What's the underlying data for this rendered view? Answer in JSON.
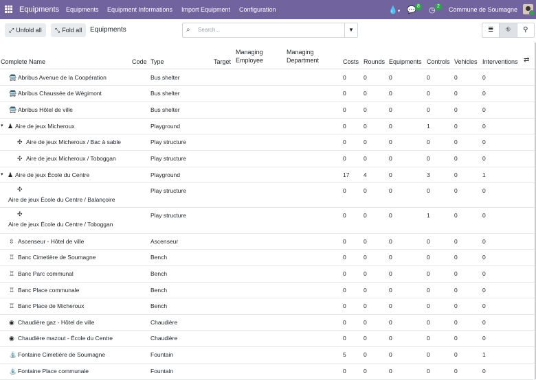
{
  "app": {
    "title": "Equipments",
    "menu": [
      "Equipments",
      "Equipment Informations",
      "Import Equipment",
      "Configuration"
    ],
    "badges": {
      "messages": "8",
      "activities": "2"
    },
    "company": "Commune de Soumagne"
  },
  "control_panel": {
    "unfold_label": "Unfold all",
    "fold_label": "Fold all",
    "page_title": "Equipments",
    "search_placeholder": "Search..."
  },
  "columns": [
    "Complete Name",
    "Code",
    "Type",
    "Target",
    "Managing Employee",
    "Managing Department",
    "Costs",
    "Rounds",
    "Equipments",
    "Controls",
    "Vehicles",
    "Interventions"
  ],
  "rows": [
    {
      "name": "Abribus Avenue de la Coopération",
      "icon": "bus-icon",
      "type": "Bus shelter",
      "costs": "0",
      "rounds": "0",
      "equipments": "0",
      "controls": "0",
      "vehicles": "0",
      "interventions": "0"
    },
    {
      "name": "Abribus Chaussée de Wégimont",
      "icon": "bus-icon",
      "type": "Bus shelter",
      "costs": "0",
      "rounds": "0",
      "equipments": "0",
      "controls": "0",
      "vehicles": "0",
      "interventions": "0"
    },
    {
      "name": "Abribus Hôtel de ville",
      "icon": "bus-icon",
      "type": "Bus shelter",
      "costs": "0",
      "rounds": "0",
      "equipments": "0",
      "controls": "0",
      "vehicles": "0",
      "interventions": "0"
    },
    {
      "name": "Aire de jeux Micheroux",
      "icon": "child-icon",
      "type": "Playground",
      "costs": "0",
      "rounds": "0",
      "equipments": "0",
      "controls": "1",
      "vehicles": "0",
      "interventions": "0"
    },
    {
      "name": "Aire de jeux Micheroux / Bac à sable",
      "icon": "puzzle-icon",
      "type": "Play structure",
      "costs": "0",
      "rounds": "0",
      "equipments": "0",
      "controls": "0",
      "vehicles": "0",
      "interventions": "0"
    },
    {
      "name": "Aire de jeux Micheroux / Toboggan",
      "icon": "puzzle-icon",
      "type": "Play structure",
      "costs": "0",
      "rounds": "0",
      "equipments": "0",
      "controls": "0",
      "vehicles": "0",
      "interventions": "0"
    },
    {
      "name": "Aire de jeux École du Centre",
      "icon": "child-icon",
      "type": "Playground",
      "costs": "17",
      "rounds": "4",
      "equipments": "0",
      "controls": "3",
      "vehicles": "0",
      "interventions": "1"
    },
    {
      "name": "Aire de jeux École du Centre / Balançoire",
      "icon": "puzzle-icon",
      "type": "Play structure",
      "costs": "0",
      "rounds": "0",
      "equipments": "0",
      "controls": "0",
      "vehicles": "0",
      "interventions": "0"
    },
    {
      "name": "Aire de jeux École du Centre / Toboggan",
      "icon": "puzzle-icon",
      "type": "Play structure",
      "costs": "0",
      "rounds": "0",
      "equipments": "0",
      "controls": "1",
      "vehicles": "0",
      "interventions": "0"
    },
    {
      "name": "Ascenseur - Hôtel de ville",
      "icon": "elevator-icon",
      "type": "Ascenseur",
      "costs": "0",
      "rounds": "0",
      "equipments": "0",
      "controls": "0",
      "vehicles": "0",
      "interventions": "0"
    },
    {
      "name": "Banc Cimetière de Soumagne",
      "icon": "bench-icon",
      "type": "Bench",
      "costs": "0",
      "rounds": "0",
      "equipments": "0",
      "controls": "0",
      "vehicles": "0",
      "interventions": "0"
    },
    {
      "name": "Banc Parc communal",
      "icon": "bench-icon",
      "type": "Bench",
      "costs": "0",
      "rounds": "0",
      "equipments": "0",
      "controls": "0",
      "vehicles": "0",
      "interventions": "0"
    },
    {
      "name": "Banc Place communale",
      "icon": "bench-icon",
      "type": "Bench",
      "costs": "0",
      "rounds": "0",
      "equipments": "0",
      "controls": "0",
      "vehicles": "0",
      "interventions": "0"
    },
    {
      "name": "Banc Place de Micheroux",
      "icon": "bench-icon",
      "type": "Bench",
      "costs": "0",
      "rounds": "0",
      "equipments": "0",
      "controls": "0",
      "vehicles": "0",
      "interventions": "0"
    },
    {
      "name": "Chaudière gaz - Hôtel de ville",
      "icon": "flame-icon",
      "type": "Chaudière",
      "costs": "0",
      "rounds": "0",
      "equipments": "0",
      "controls": "0",
      "vehicles": "0",
      "interventions": "0"
    },
    {
      "name": "Chaudière mazout - École du Centre",
      "icon": "flame-icon",
      "type": "Chaudière",
      "costs": "0",
      "rounds": "0",
      "equipments": "0",
      "controls": "0",
      "vehicles": "0",
      "interventions": "0"
    },
    {
      "name": "Fontaine Cimetière de Soumagne",
      "icon": "faucet-icon",
      "type": "Fountain",
      "costs": "5",
      "rounds": "0",
      "equipments": "0",
      "controls": "0",
      "vehicles": "0",
      "interventions": "1"
    },
    {
      "name": "Fontaine Place communale",
      "icon": "faucet-icon",
      "type": "Fountain",
      "costs": "0",
      "rounds": "0",
      "equipments": "0",
      "controls": "0",
      "vehicles": "0",
      "interventions": "0"
    }
  ]
}
